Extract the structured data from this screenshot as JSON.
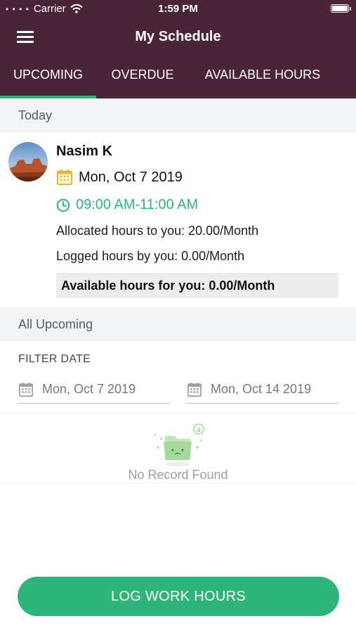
{
  "status_bar": {
    "carrier": "Carrier",
    "time": "1:59 PM"
  },
  "header": {
    "title": "My Schedule"
  },
  "tabs": [
    {
      "label": "UPCOMING",
      "active": true
    },
    {
      "label": "OVERDUE",
      "active": false
    },
    {
      "label": "AVAILABLE HOURS",
      "active": false
    }
  ],
  "today": {
    "section_label": "Today",
    "name": "Nasim K",
    "date": "Mon, Oct 7 2019",
    "time_range": "09:00 AM-11:00 AM",
    "allocated": "Allocated hours to you: 20.00/Month",
    "logged": "Logged hours by you: 0.00/Month",
    "available": "Available hours for you: 0.00/Month"
  },
  "all_upcoming": {
    "section_label": "All Upcoming",
    "filter_label": "FILTER DATE",
    "from_date": "Mon, Oct 7 2019",
    "to_date": "Mon, Oct 14 2019",
    "empty_text": "No Record Found"
  },
  "actions": {
    "log_button": "LOG WORK HOURS"
  },
  "colors": {
    "header_bg": "#4a2538",
    "accent": "#2db57c",
    "calendar_icon": "#f0b429"
  },
  "icons": [
    "menu-icon",
    "wifi-icon",
    "battery-icon",
    "calendar-icon",
    "clock-icon",
    "no-record-folder-icon"
  ]
}
